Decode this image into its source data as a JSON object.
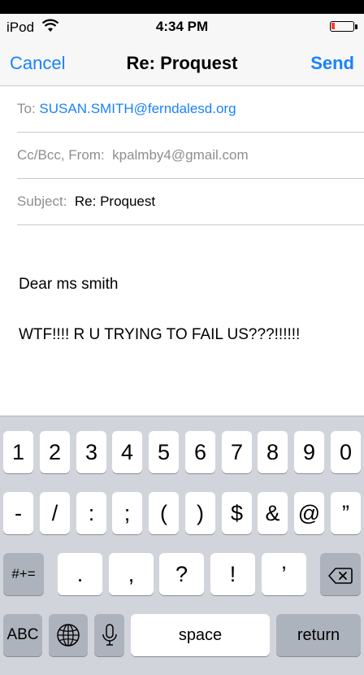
{
  "status_bar": {
    "carrier": "iPod",
    "time": "4:34 PM"
  },
  "nav": {
    "cancel": "Cancel",
    "title": "Re: Proquest",
    "send": "Send"
  },
  "fields": {
    "to_label": "To:",
    "to_value": "SUSAN.SMITH@ferndalesd.org",
    "ccbcc_label": "Cc/Bcc, From:",
    "from_value": "kpalmby4@gmail.com",
    "subject_label": "Subject:",
    "subject_value": "Re: Proquest"
  },
  "body": {
    "line1": "Dear ms smith",
    "line2": "WTF!!!! R U TRYING TO FAIL US???!!!!!!"
  },
  "keyboard": {
    "row1": [
      "1",
      "2",
      "3",
      "4",
      "5",
      "6",
      "7",
      "8",
      "9",
      "0"
    ],
    "row2": [
      "-",
      "/",
      ":",
      ";",
      "(",
      ")",
      "$",
      "&",
      "@",
      "”"
    ],
    "row3": [
      ".",
      ",",
      "?",
      "!",
      "’"
    ],
    "symbols_toggle": "#+=",
    "abc": "ABC",
    "space": "space",
    "return": "return"
  },
  "colors": {
    "accent": "#1a82fb",
    "keyboard_bg": "#d1d5db",
    "battery_low": "#ff3b30"
  },
  "icons": {
    "wifi": "wifi-icon",
    "battery": "battery-icon",
    "globe": "globe-icon",
    "mic": "microphone-icon",
    "delete": "backspace-icon"
  }
}
